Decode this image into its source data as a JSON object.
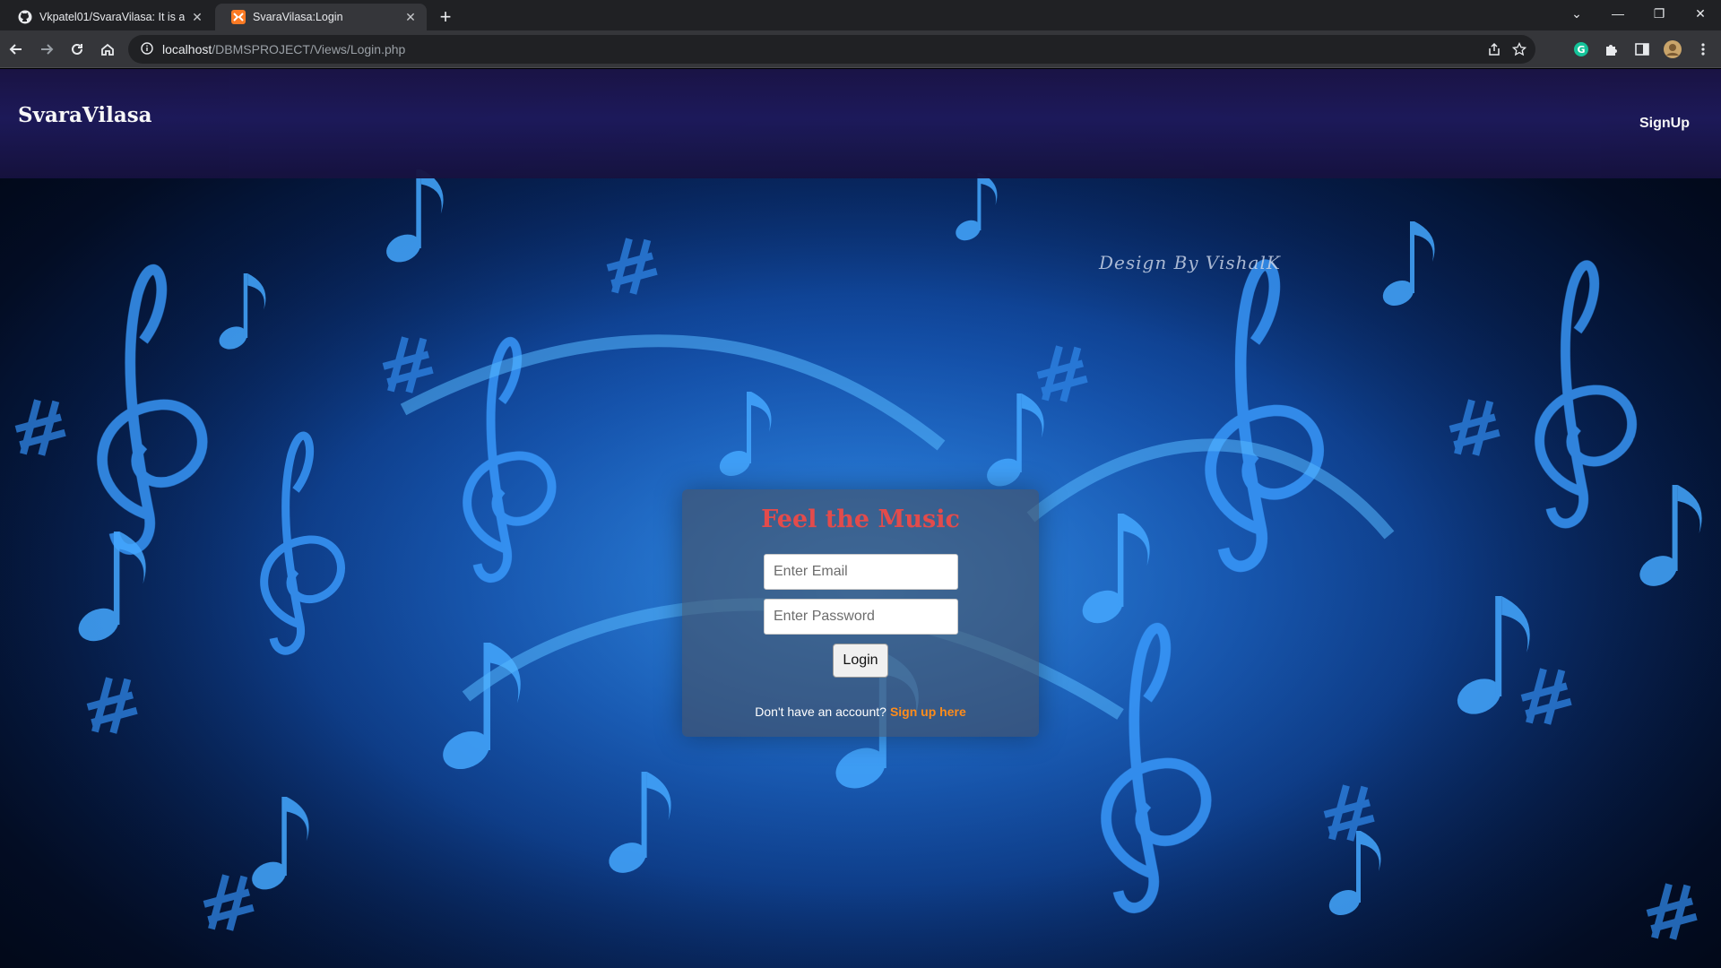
{
  "browser": {
    "tabs": [
      {
        "title": "Vkpatel01/SvaraVilasa: It is a mu",
        "active": false,
        "favicon": "github-icon"
      },
      {
        "title": "SvaraVilasa:Login",
        "active": true,
        "favicon": "xampp-icon"
      }
    ],
    "new_tab": "+",
    "address": {
      "host": "localhost",
      "path": "/DBMSPROJECT/Views/Login.php"
    }
  },
  "site": {
    "brand": "SvaraVilasa",
    "nav_signup": "SignUp",
    "credit": "Design By VishalK"
  },
  "login": {
    "title": "Feel the Music",
    "email_placeholder": "Enter Email",
    "password_placeholder": "Enter Password",
    "button": "Login",
    "signup_prompt": "Don't have an account?",
    "signup_link": "Sign up here"
  },
  "colors": {
    "title_red": "#e34b4b",
    "link_orange": "#ff8c1a",
    "header_navy": "#1d1a5b",
    "note_blue": "#3aa0ff"
  }
}
